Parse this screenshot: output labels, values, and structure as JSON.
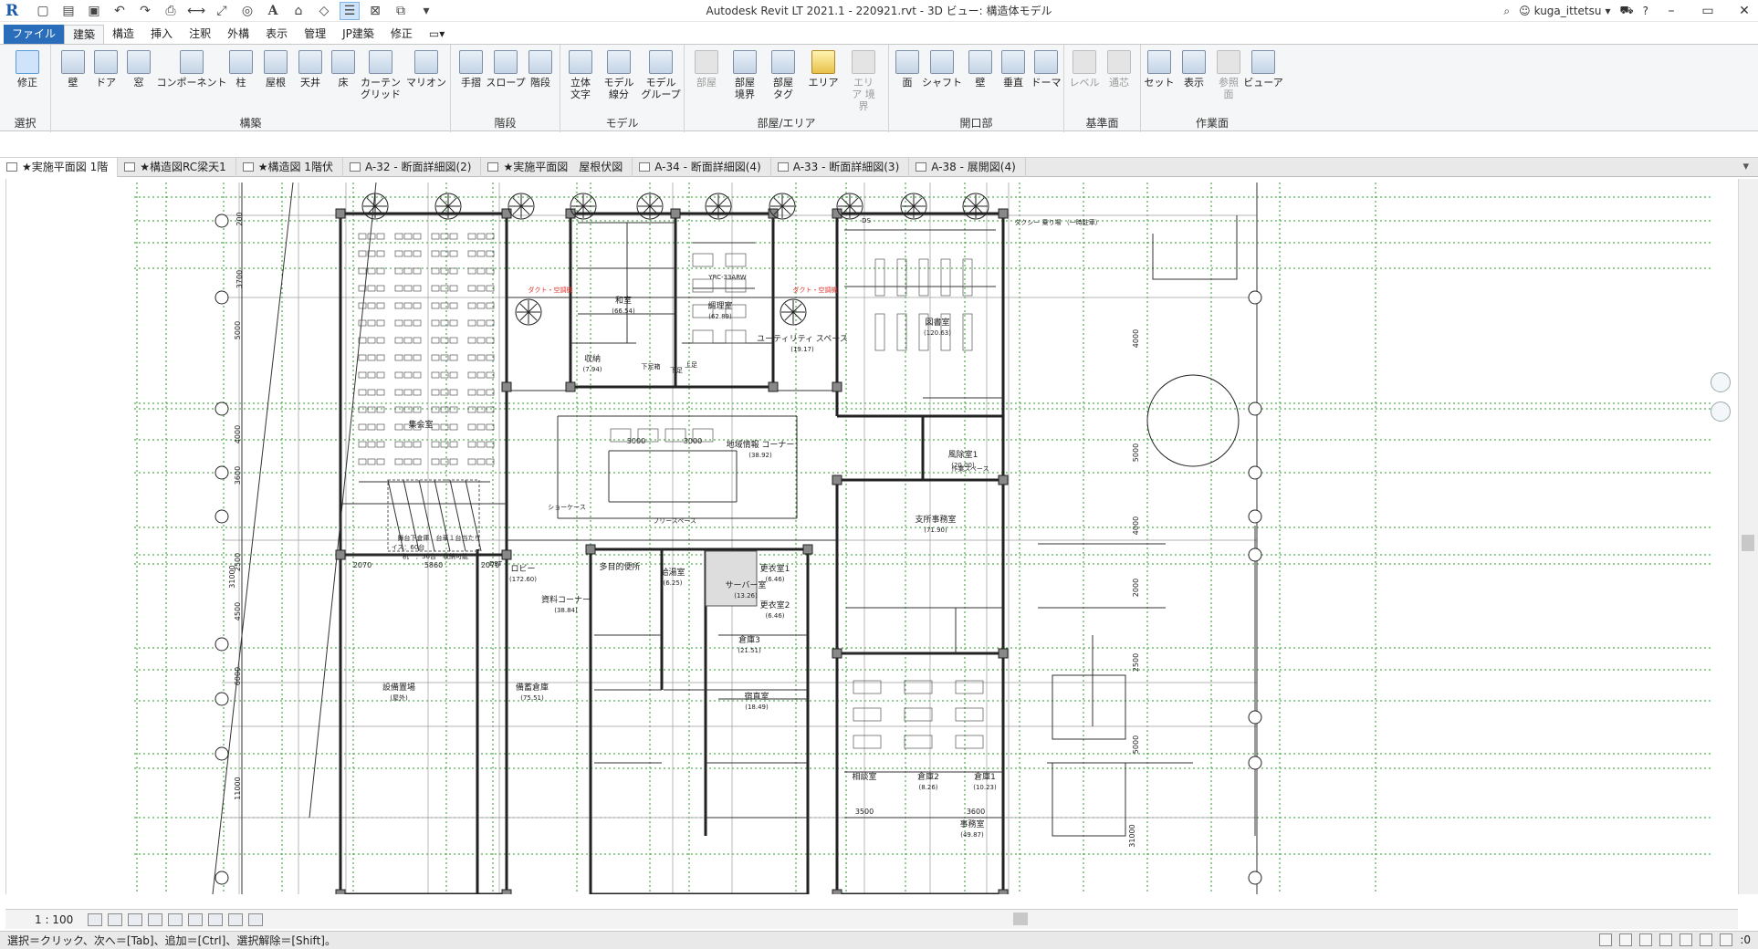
{
  "app": {
    "title": "Autodesk Revit LT 2021.1 - 220921.rvt - 3D ビュー: 構造体モデル",
    "logo": "R",
    "user": "kuga_ittetsu"
  },
  "qat_icons": [
    "open-icon",
    "save-icon",
    "undo-icon",
    "redo-icon",
    "print-icon",
    "measure-icon",
    "dimension-icon",
    "text-icon",
    "3d-view-icon",
    "section-icon",
    "thin-lines-icon",
    "close-hidden-icon",
    "switch-windows-icon",
    "customize-icon"
  ],
  "ribbon_tabs": [
    "ファイル",
    "建築",
    "構造",
    "挿入",
    "注釈",
    "外構",
    "表示",
    "管理",
    "JP建築",
    "修正"
  ],
  "ribbon": {
    "select": {
      "label": "修正",
      "group": "選択"
    },
    "groups": [
      {
        "name": "構築",
        "buttons": [
          "壁",
          "ドア",
          "窓",
          "コンポーネント",
          "柱",
          "屋根",
          "天井",
          "床",
          "カーテン グリッド",
          "マリオン"
        ]
      },
      {
        "name": "階段",
        "buttons": [
          "手摺",
          "スロープ",
          "階段"
        ]
      },
      {
        "name": "モデル",
        "buttons": [
          "立体 文字",
          "モデル 線分",
          "モデル グループ"
        ]
      },
      {
        "name": "部屋/エリア",
        "buttons": [
          "部屋",
          "部屋 境界",
          "部屋 タグ",
          "エリア",
          "エリア 境界"
        ]
      },
      {
        "name": "開口部",
        "buttons": [
          "面",
          "シャフト",
          "壁",
          "垂直",
          "ドーマ"
        ]
      },
      {
        "name": "基準面",
        "buttons": [
          "レベル",
          "通芯"
        ]
      },
      {
        "name": "作業面",
        "buttons": [
          "セット",
          "表示",
          "参照 面",
          "ビューア"
        ]
      }
    ]
  },
  "doc_tabs": [
    "★実施平面図 1階",
    "★構造図RC梁天1",
    "★構造図 1階伏",
    "A-32 - 断面詳細図(2)",
    "★実施平面図　屋根伏図",
    "A-34 - 断面詳細図(4)",
    "A-33 - 断面詳細図(3)",
    "A-38 - 展開図(4)"
  ],
  "floor_plan": {
    "rooms": [
      {
        "name": "ダクト・設備",
        "label": "ダクト・空調機",
        "color": "#e0302a"
      },
      {
        "name": "和室",
        "area": "(66.54)"
      },
      {
        "name": "調理室",
        "area": "(62.89)"
      },
      {
        "name": "ユーティリティ スペース",
        "area": "(19.17)"
      },
      {
        "name": "図書室",
        "area": "(120.63)"
      },
      {
        "name": "収納",
        "area": "(7.94)"
      },
      {
        "name": "ロビー",
        "area": "(172.60)"
      },
      {
        "name": "資料コーナー",
        "area": "(38.84)"
      },
      {
        "name": "地域情報 コーナー",
        "area": "(38.92)"
      },
      {
        "name": "風除室1",
        "area": "(20.00)"
      },
      {
        "name": "支所事務室",
        "area": "(71.90)"
      },
      {
        "name": "設備置場",
        "area": "(屋外)"
      },
      {
        "name": "備蓄倉庫",
        "area": "(75.51)"
      },
      {
        "name": "サーバー室",
        "area": "(13.26)"
      },
      {
        "name": "倉庫3",
        "area": "(21.51)"
      },
      {
        "name": "宿直室",
        "area": "(18.49)"
      },
      {
        "name": "相談室",
        "area": ""
      },
      {
        "name": "倉庫2",
        "area": "(8.26)"
      },
      {
        "name": "倉庫1",
        "area": "(10.23)"
      },
      {
        "name": "事務室",
        "area": "(49.87)"
      },
      {
        "name": "多目的便所",
        "area": ""
      },
      {
        "name": "給湯室",
        "area": "(6.25)"
      },
      {
        "name": "更衣室1",
        "area": "(6.46)"
      },
      {
        "name": "更衣室2",
        "area": "(6.46)"
      }
    ],
    "hall": {
      "name": "集会室",
      "seats": "イス：60台",
      "desks": "机　：36台　収納可能",
      "note": "舞台下倉庫　台車１台当たり"
    },
    "misc_labels": [
      "作業スペース",
      "ショーケース",
      "フリースペース",
      "YRC-33ARW",
      "下足箱",
      "上足",
      "下足",
      "タクシー 乗り場 （一時駐車）",
      "DS",
      "DST"
    ],
    "grid_left": [
      "Y9",
      "Y8",
      "Y7",
      "Y6",
      "Y5",
      "Y4",
      "Y3",
      "Y2",
      "Y1"
    ],
    "grid_right": [
      "Y9",
      "Y8",
      "Y7",
      "Y6",
      "Y5",
      "Y3",
      "Y2",
      "Y1"
    ],
    "dimensions_left": [
      "200",
      "3700",
      "5000",
      "4000",
      "3600",
      "2500",
      "4500",
      "6000",
      "11000",
      "31000"
    ],
    "dimensions_right": [
      "4000",
      "5000",
      "4000",
      "2000",
      "2500",
      "5000",
      "31000"
    ],
    "dims_misc": [
      "2070",
      "5860",
      "2070",
      "3000",
      "3000",
      "3500",
      "3600"
    ]
  },
  "view_bar": {
    "scale": "1 : 100"
  },
  "status": {
    "message": "選択＝クリック、次へ＝[Tab]、追加＝[Ctrl]、選択解除＝[Shift]。",
    "filter_count": ":0"
  },
  "colors": {
    "file_tab": "#2a6ebb",
    "grid_line": "#2a9a2a",
    "red_note": "#e0302a"
  }
}
